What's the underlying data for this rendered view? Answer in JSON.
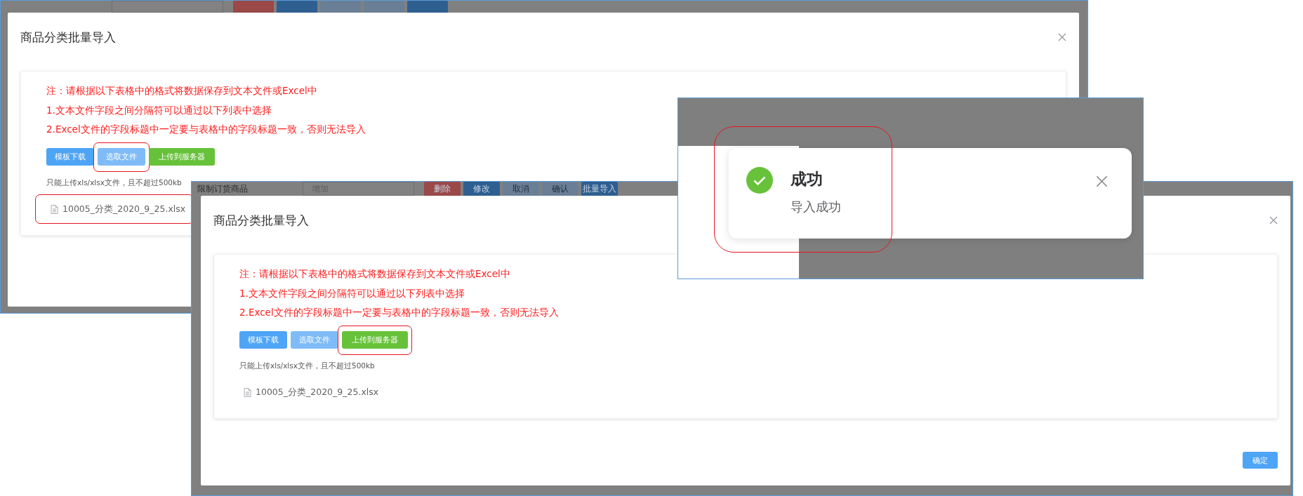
{
  "panels": [
    {
      "kind": "import_dialog",
      "toolbar": {
        "buttons": [
          {
            "kind": "danger"
          },
          {
            "kind": "primary"
          },
          {
            "kind": "muted"
          },
          {
            "kind": "muted"
          },
          {
            "kind": "primary"
          }
        ]
      },
      "dialog": {
        "title": "商品分类批量导入",
        "notes": [
          "注：请根据以下表格中的格式将数据保存到文本文件或Excel中",
          "1.文本文件字段之间分隔符可以通过以下列表中选择",
          "2.Excel文件的字段标题中一定要与表格中的字段标题一致，否则无法导入"
        ],
        "buttons": [
          {
            "label": "模板下载",
            "kind": "primary",
            "highlighted": false
          },
          {
            "label": "选取文件",
            "kind": "light",
            "highlighted": true
          },
          {
            "label": "上传到服务器",
            "kind": "success",
            "highlighted": false
          }
        ],
        "hint": "只能上传xls/xlsx文件，且不超过500kb",
        "file": {
          "name": "10005_分类_2020_9_25.xlsx",
          "highlighted": true
        }
      }
    },
    {
      "kind": "import_dialog",
      "toolbar": {
        "breadcrumb": "限制订货商品",
        "select_placeholder": "增加",
        "buttons": [
          {
            "label": "删除",
            "kind": "danger"
          },
          {
            "label": "修改",
            "kind": "primary"
          },
          {
            "label": "取消",
            "kind": "muted"
          },
          {
            "label": "确认",
            "kind": "muted"
          },
          {
            "label": "批量导入",
            "kind": "primary"
          }
        ]
      },
      "dialog": {
        "title": "商品分类批量导入",
        "notes": [
          "注：请根据以下表格中的格式将数据保存到文本文件或Excel中",
          "1.文本文件字段之间分隔符可以通过以下列表中选择",
          "2.Excel文件的字段标题中一定要与表格中的字段标题一致，否则无法导入"
        ],
        "buttons": [
          {
            "label": "模板下载",
            "kind": "primary",
            "highlighted": false
          },
          {
            "label": "选取文件",
            "kind": "light",
            "highlighted": false
          },
          {
            "label": "上传到服务器",
            "kind": "success",
            "highlighted": true
          }
        ],
        "hint": "只能上传xls/xlsx文件，且不超过500kb",
        "file": {
          "name": "10005_分类_2020_9_25.xlsx",
          "highlighted": false
        },
        "confirm_button": "确定"
      }
    },
    {
      "kind": "notification",
      "color": "#67c23a",
      "title": "成功",
      "message": "导入成功",
      "highlighted": true
    }
  ]
}
